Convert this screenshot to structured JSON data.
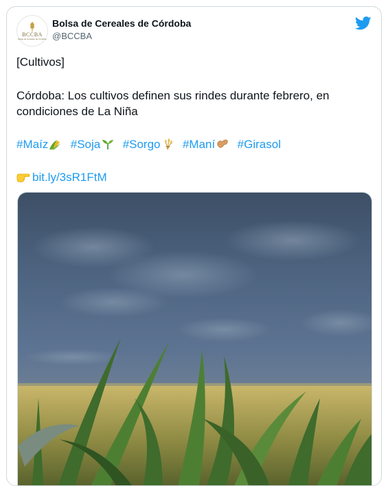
{
  "account": {
    "name": "Bolsa de Cereales de Córdoba",
    "handle": "@BCCBA",
    "avatar_text": "BCCBA",
    "avatar_subtext": "Bolsa de Cereales de Córdoba"
  },
  "tweet": {
    "category": "[Cultivos]",
    "body": "Córdoba: Los cultivos definen sus rindes durante febrero, en condiciones de La Niña",
    "hashtags": [
      {
        "text": "#Maíz",
        "emoji": "corn-icon"
      },
      {
        "text": "#Soja",
        "emoji": "seedling-icon"
      },
      {
        "text": "#Sorgo",
        "emoji": "sheaf-icon"
      },
      {
        "text": "#Maní",
        "emoji": "peanut-icon"
      },
      {
        "text": "#Girasol",
        "emoji": ""
      }
    ],
    "link": "bit.ly/3sR1FtM",
    "link_emoji": "pointing-hand-icon"
  },
  "photo": {
    "description_icon": "cornfield-photo"
  },
  "colors": {
    "link": "#1d9bf0",
    "text": "#0f1419",
    "muted": "#536471",
    "border": "#cfd9de"
  }
}
